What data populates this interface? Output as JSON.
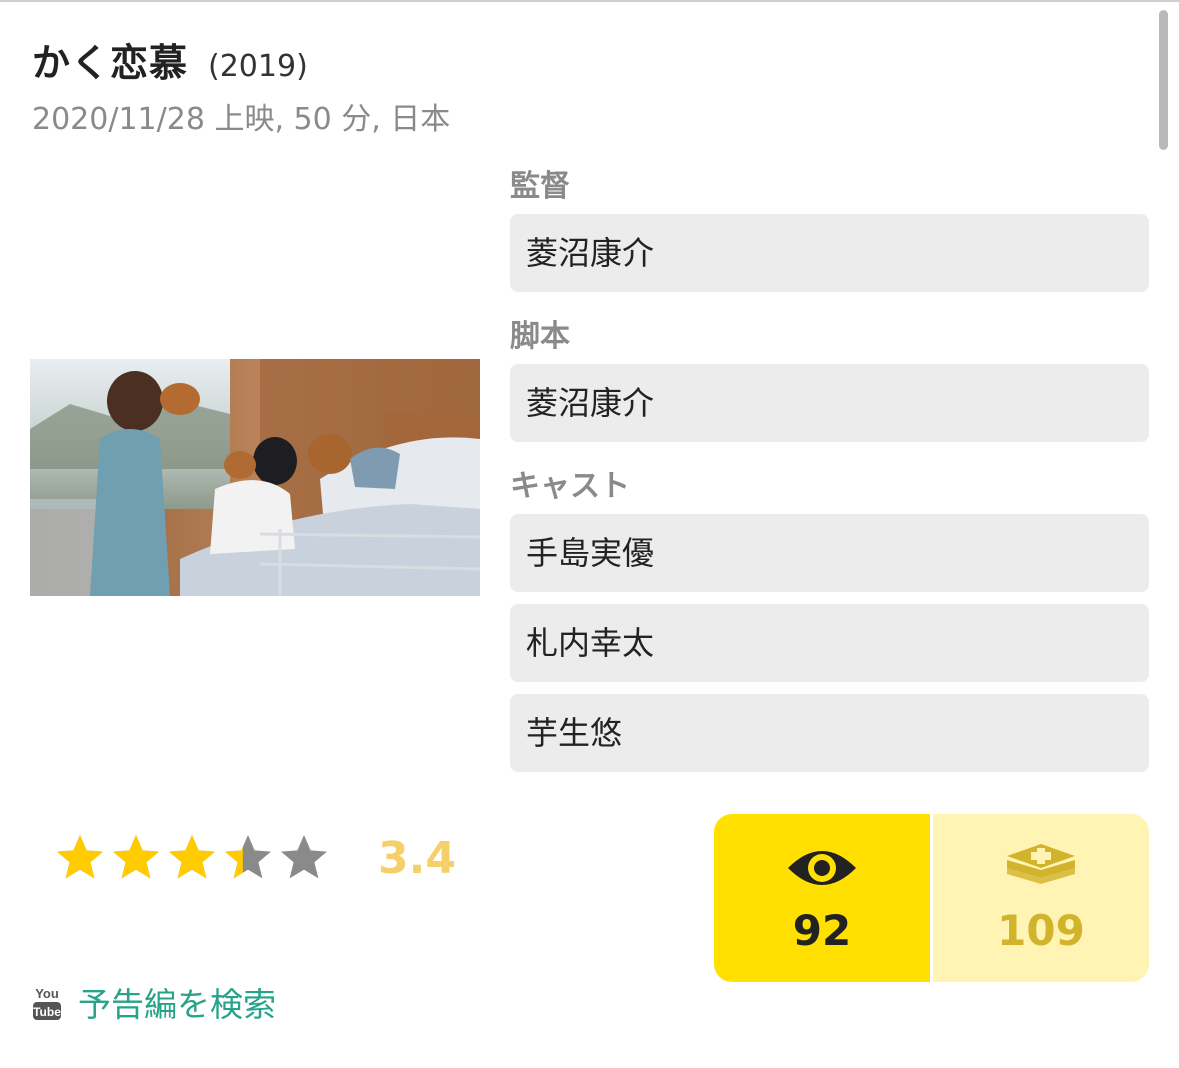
{
  "movie": {
    "title": "かく恋慕",
    "year": "(2019)",
    "meta": "2020/11/28 上映, 50 分, 日本",
    "poster_icon": "movie-still-image"
  },
  "crew": {
    "director_label": "監督",
    "directors": [
      "菱沼康介"
    ],
    "writer_label": "脚本",
    "writers": [
      "菱沼康介"
    ],
    "cast_label": "キャスト",
    "cast": [
      "手島実優",
      "札内幸太",
      "芋生悠"
    ]
  },
  "rating": {
    "value": 3.4,
    "display": "3.4",
    "max_stars": 5,
    "star_color": "#ffcc00",
    "empty_star_color": "#8a8a8a",
    "score_color": "#f5cf6a"
  },
  "stats": {
    "watched_count": "92",
    "watched_icon": "eye-icon",
    "want_count": "109",
    "want_icon": "add-to-stack-icon",
    "watched_color": "#ffe000",
    "want_color": "#fff4b3"
  },
  "trailer": {
    "icon": "youtube-icon",
    "label": "予告編を検索",
    "color": "#27a38a"
  }
}
